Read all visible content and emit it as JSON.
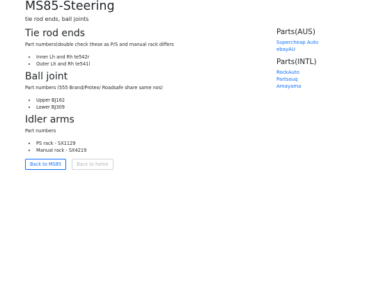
{
  "page": {
    "title": "MS85-Steering",
    "subtitle": "tie rod ends, ball joints"
  },
  "sections": [
    {
      "heading": "Tie rod ends",
      "description": "Part numbers(double check these as P/S and manual rack differs",
      "items": [
        "Inner Lh and Rh te542r",
        "Outer Lh and Rh te541l"
      ]
    },
    {
      "heading": "Ball joint",
      "description": "Part numbers (555 Brand/Protex/ Roadsafe share same nos)",
      "items": [
        "Upper BJ162",
        "Lower BJ309"
      ]
    },
    {
      "heading": "Idler arms",
      "description": "Part numbers",
      "items": [
        "PS rack - SX1129",
        "Manual rack - SX4219"
      ]
    }
  ],
  "buttons": {
    "back_to_ms85": "Back to MS85",
    "back_to_home": "Back to home"
  },
  "sidebar": {
    "aus_heading": "Parts(AUS)",
    "aus_links": [
      "Supercheap Auto",
      "ebayAU"
    ],
    "intl_heading": "Parts(INTL)",
    "intl_links": [
      "RockAuto",
      "Partsouq",
      "Amayama"
    ]
  }
}
